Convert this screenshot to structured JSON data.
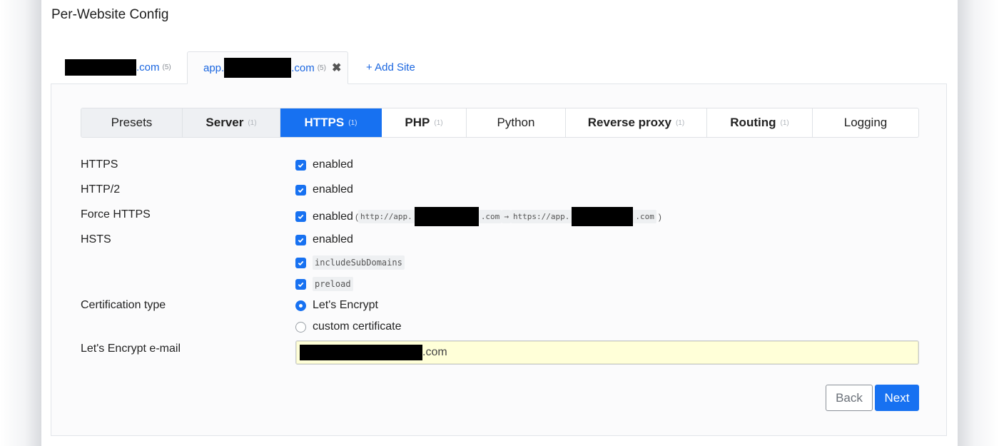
{
  "page": {
    "title": "Per-Website Config"
  },
  "site_tabs": [
    {
      "domain_suffix": ".com",
      "count": "(5)"
    },
    {
      "prefix": "app.",
      "domain_suffix": ".com",
      "count": "(5)",
      "close": "✖"
    },
    {
      "label": "+ Add Site"
    }
  ],
  "section_tabs": [
    {
      "label": "Presets",
      "count": ""
    },
    {
      "label": "Server",
      "count": "(1)"
    },
    {
      "label": "HTTPS",
      "count": "(1)"
    },
    {
      "label": "PHP",
      "count": "(1)"
    },
    {
      "label": "Python",
      "count": ""
    },
    {
      "label": "Reverse proxy",
      "count": "(1)"
    },
    {
      "label": "Routing",
      "count": "(1)"
    },
    {
      "label": "Logging",
      "count": ""
    }
  ],
  "form": {
    "https": {
      "label": "HTTPS",
      "value": "enabled"
    },
    "http2": {
      "label": "HTTP/2",
      "value": "enabled"
    },
    "force_https": {
      "label": "Force HTTPS",
      "value": "enabled",
      "open_paren": "(",
      "from_prefix": "http://app.",
      "from_suffix": ".com",
      "arrow": "→",
      "to_prefix": "https://app.",
      "to_suffix": ".com",
      "close_paren": ")"
    },
    "hsts": {
      "label": "HSTS",
      "value": "enabled",
      "option1": "includeSubDomains",
      "option2": "preload"
    },
    "cert_type": {
      "label": "Certification type",
      "option1": "Let's Encrypt",
      "option2": "custom certificate",
      "selected": "Let's Encrypt"
    },
    "le_email": {
      "label": "Let's Encrypt e-mail",
      "value_suffix": ".com"
    }
  },
  "buttons": {
    "back": "Back",
    "next": "Next"
  },
  "colors": {
    "accent": "#1771f1",
    "input_bg": "#ffffd8"
  }
}
